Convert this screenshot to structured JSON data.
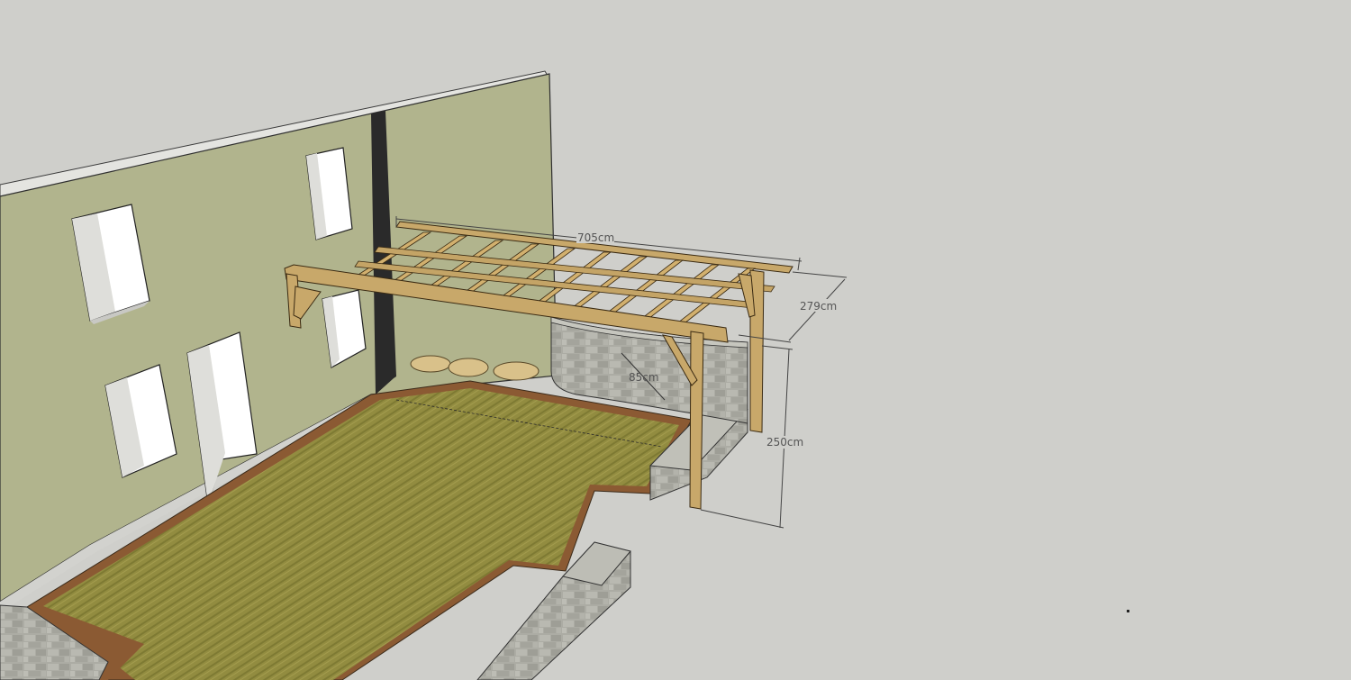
{
  "model": {
    "dimensions": {
      "pergola_length": "705cm",
      "pergola_depth": "279cm",
      "pergola_height": "250cm",
      "planter_radius": "85cm"
    }
  },
  "colors": {
    "background": "#cfcfcb",
    "wall": "#b1b48d",
    "wall_top": "#e4e4e0",
    "deck": "#8f8a3e",
    "deck_border": "#8b5a33",
    "timber": "#c8a86a",
    "stone": "#a9a9a1",
    "downpipe": "#2a2a2a"
  }
}
